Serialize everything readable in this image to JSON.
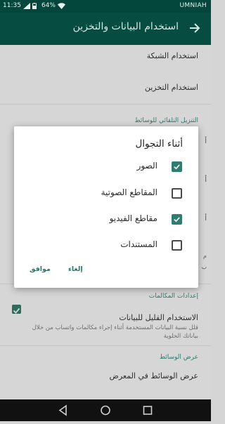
{
  "status_bar": {
    "time": "11:35",
    "battery": "64%",
    "carrier": "UMNIAH"
  },
  "app_bar": {
    "title": "استخدام البيانات والتخزين",
    "back_icon": "arrow-right-icon"
  },
  "settings": {
    "network_usage": "استخدام الشبكة",
    "storage_usage": "استخدام التخزين",
    "media_auto_download_header": "التنزيل التلقائي للوسائط",
    "calls_header": "إعدادات المكالمات",
    "low_data_title": "الاستخدام القليل للبيانات",
    "low_data_desc": "قلل نسبة البيانات المستخدمة أثناء إجراء مكالمات واتساب من خلال بياناتك الخلوية",
    "low_data_checked": true,
    "media_display_header": "عرض الوسائط",
    "show_media_gallery": "عرض الوسائط في المعرض"
  },
  "dialog": {
    "title": "أثناء التجوال",
    "options": [
      {
        "label": "الصور",
        "checked": true
      },
      {
        "label": "المقاطع الصوتية",
        "checked": false
      },
      {
        "label": "مقاطع الفيديو",
        "checked": true
      },
      {
        "label": "المستندات",
        "checked": false
      }
    ],
    "cancel_label": "إلغاء",
    "ok_label": "موافق"
  },
  "nav_bar": {
    "back": "nav-back-icon",
    "home": "nav-home-icon",
    "recents": "nav-recents-icon"
  },
  "colors": {
    "appbar": "#064c41",
    "accent": "#2e7d6f"
  }
}
